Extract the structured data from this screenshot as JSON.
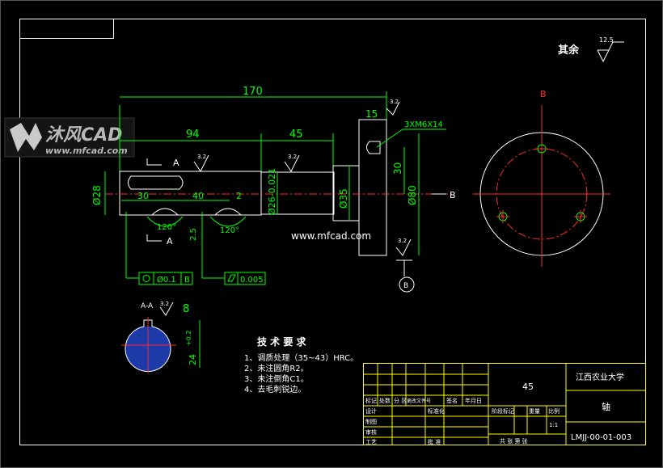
{
  "watermark": {
    "brand": "沐风CAD",
    "site": "www.mfcad.com",
    "center_url": "www.mfcad.com"
  },
  "surface": {
    "note": "其余",
    "finish_default": "12.5",
    "finish_local": "3.2"
  },
  "dimensions": {
    "overall_length": "170",
    "len_94": "94",
    "len_45": "45",
    "len_15": "15",
    "len_30a": "30",
    "len_40": "40",
    "len_2": "2",
    "len_2_5": "2.5",
    "dia_28": "Ø28",
    "dia_26": "Ø26-0.021",
    "dia_35": "Ø35",
    "dia_80": "Ø80",
    "height_30": "30",
    "thread": "3XM6X14",
    "angle": "120°",
    "key_width": "8",
    "key_depth": "24+0.2/0",
    "key_depth_main": "24",
    "key_depth_tol": "+0.2"
  },
  "views": {
    "section_a": "A",
    "section_aa": "A-A",
    "view_b": "B",
    "datum_b": "B"
  },
  "tolerances": {
    "runout": "Ø0.1",
    "runout_datum": "B",
    "cylindricity": "0.005"
  },
  "tech_requirements": {
    "title": "技 术 要 求",
    "items": [
      "1、调质处理（35~43）HRC。",
      "2、未注圆角R2。",
      "3、未注倒角C1。",
      "4、去毛刺锐边。"
    ]
  },
  "title_block": {
    "material": "45",
    "university": "江西农业大学",
    "part_name": "轴",
    "drawing_no": "LMJJ-00-01-003",
    "scale_value": "1:1",
    "headers": [
      "标记",
      "处数",
      "分 区",
      "更改文件号",
      "签名",
      "年月日"
    ],
    "rows": [
      "设计",
      "制图",
      "审核",
      "工艺"
    ],
    "std_label": "标准化",
    "approve_label": "批 准",
    "stage": "阶段标记",
    "weight": "重量",
    "scale_label": "比例",
    "sheets": "共  张  第  张"
  }
}
